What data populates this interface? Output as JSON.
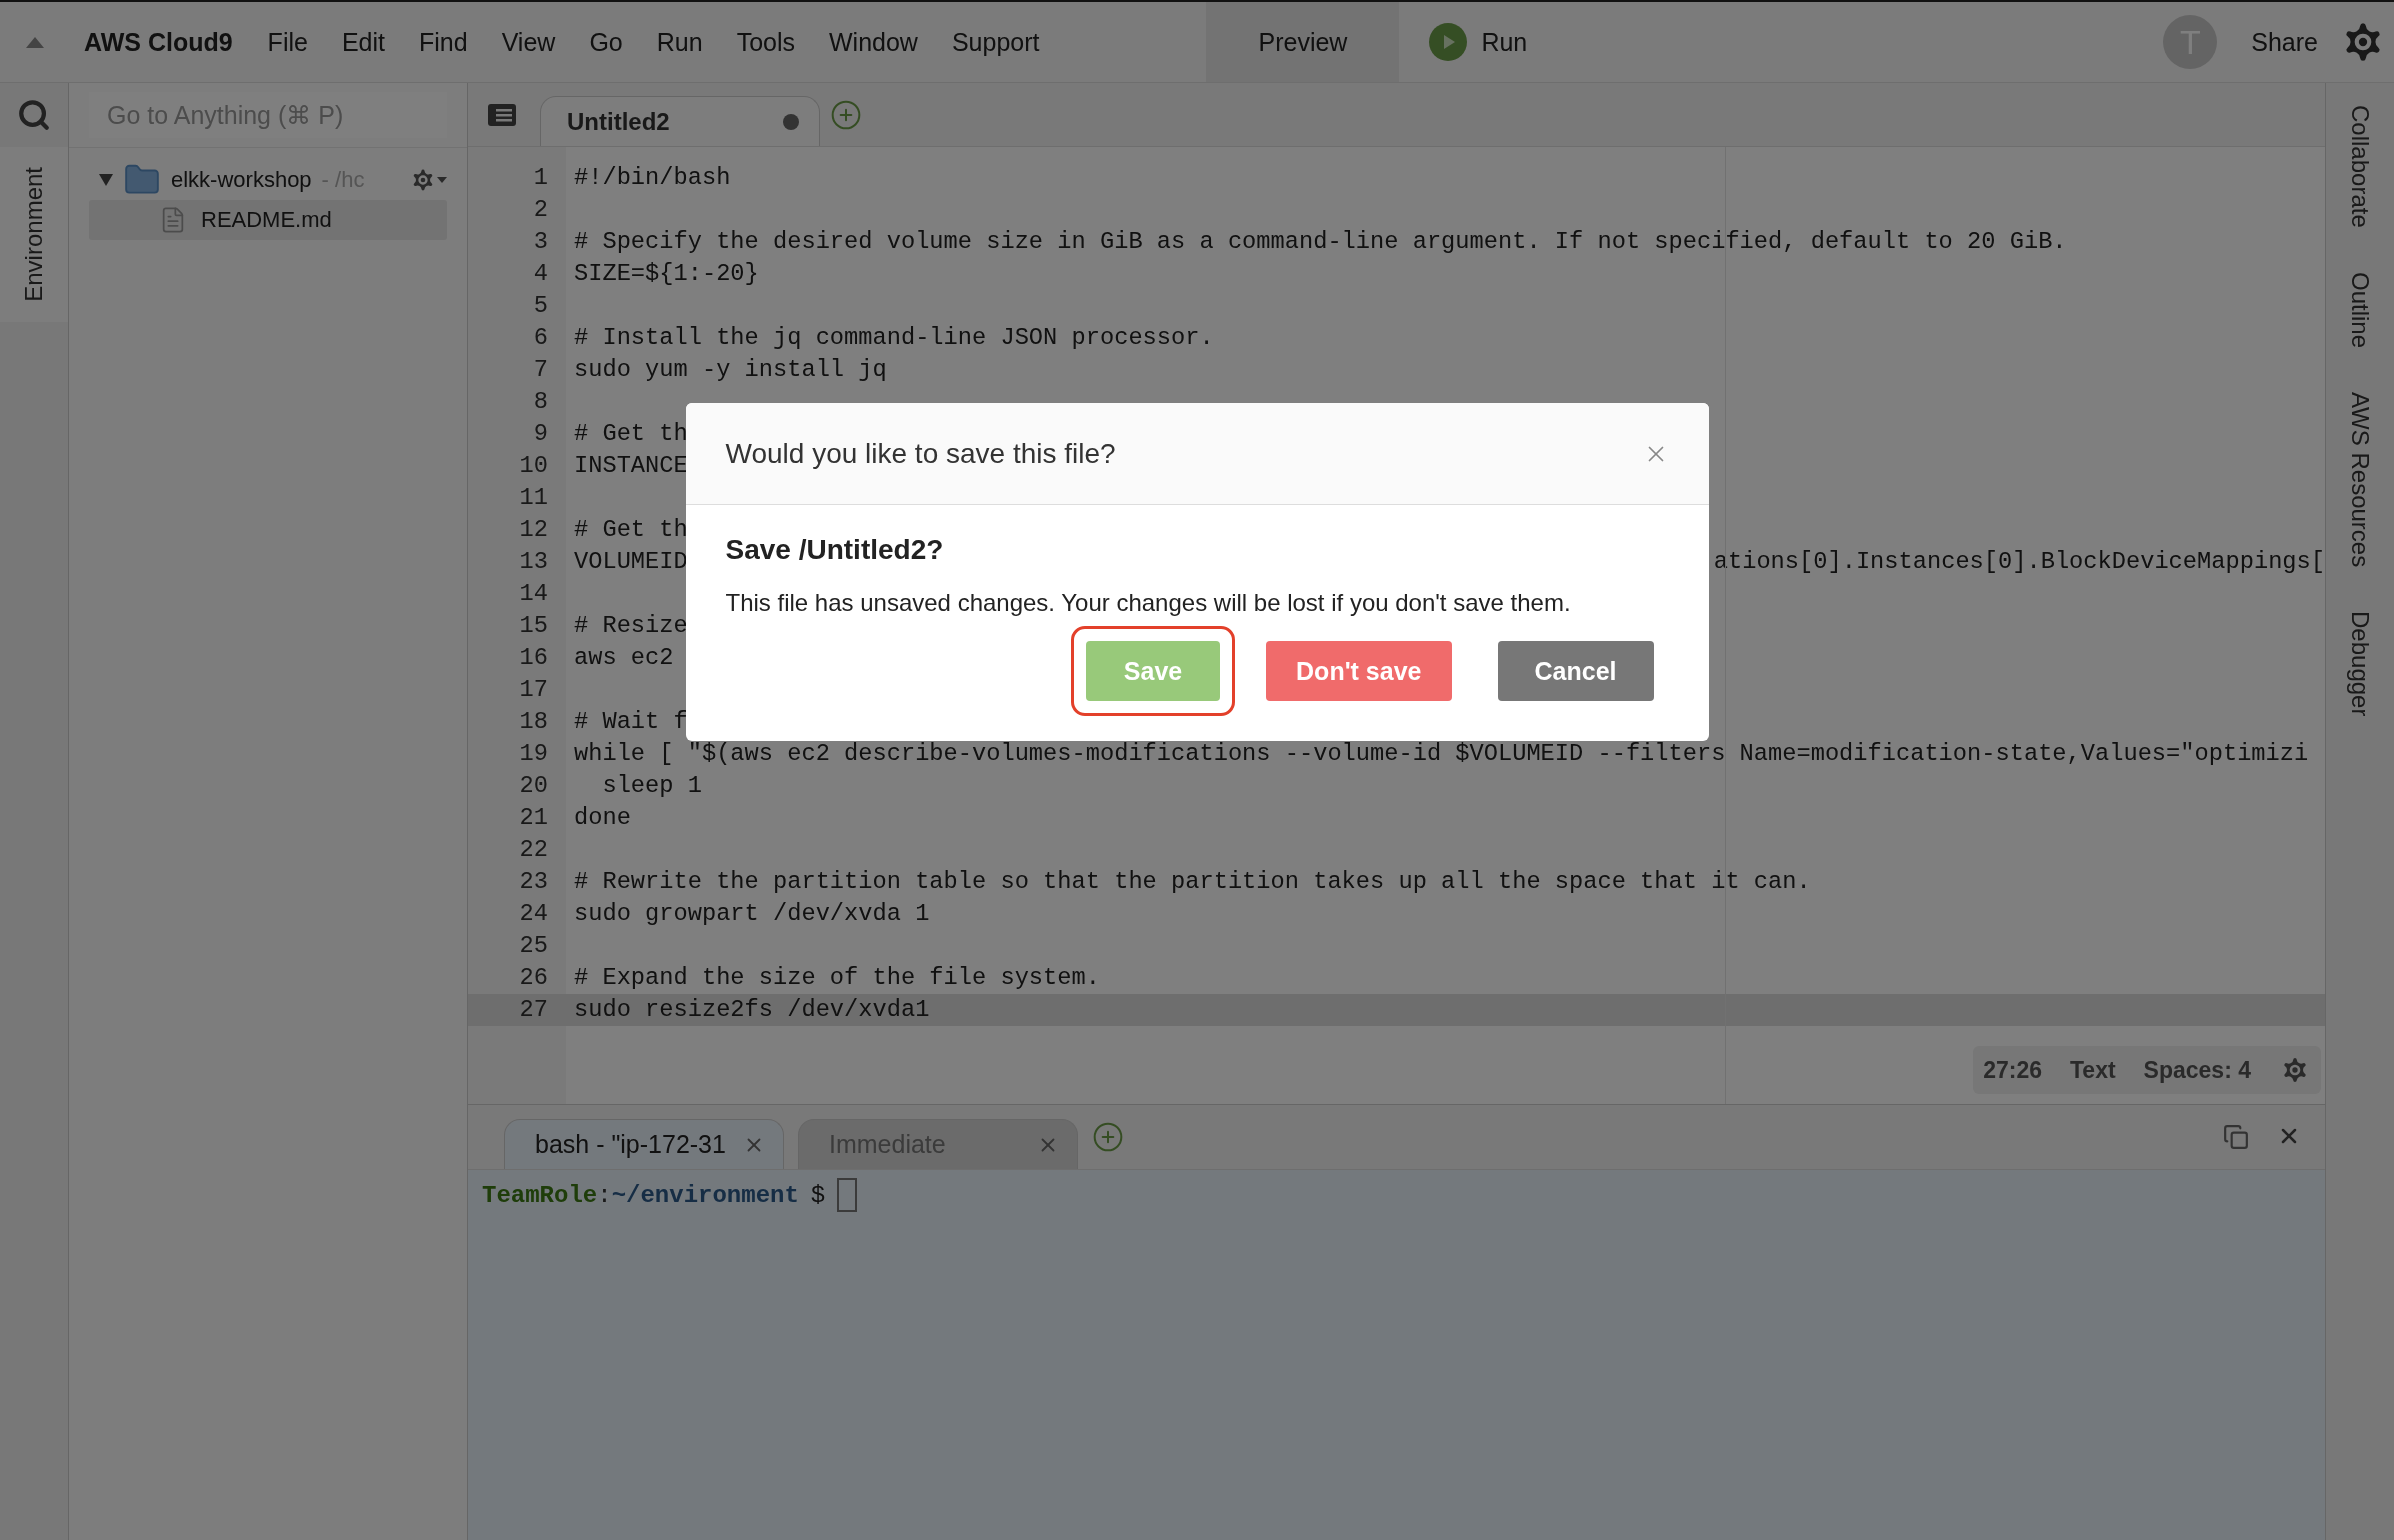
{
  "menubar": {
    "brand": "AWS Cloud9",
    "menus": [
      "File",
      "Edit",
      "Find",
      "View",
      "Go",
      "Run",
      "Tools",
      "Window",
      "Support"
    ],
    "preview": "Preview",
    "run": "Run",
    "avatar": "T",
    "share": "Share"
  },
  "left_rail": [
    {
      "label": "Environment",
      "selected": true
    }
  ],
  "search": {
    "placeholder": "Go to Anything (⌘ P)"
  },
  "tree": [
    {
      "name": "elkk-workshop",
      "path": "- /hc",
      "expanded": true,
      "children": [
        {
          "name": "README.md",
          "selected": true
        }
      ]
    }
  ],
  "editor_tabs": [
    {
      "label": "Untitled2",
      "selected": true,
      "unsaved": true
    }
  ],
  "code_lines": [
    {
      "number": "1",
      "text": "#!/bin/bash",
      "current": false
    },
    {
      "number": "2",
      "current": false
    },
    {
      "number": "3",
      "text": "# Specify the desired volume size in GiB as a command-line argument. If not specified, default to 20 GiB.",
      "current": false
    },
    {
      "number": "4",
      "text": "SIZE=${1:-20}",
      "current": false
    },
    {
      "number": "5",
      "current": false
    },
    {
      "number": "6",
      "text": "# Install the jq command-line JSON processor.",
      "current": false
    },
    {
      "number": "7",
      "text": "sudo yum -y install jq",
      "current": false
    },
    {
      "number": "8",
      "current": false
    },
    {
      "number": "9",
      "text": "# Get th",
      "current": false
    },
    {
      "number": "10",
      "text": "INSTANCE",
      "current": false
    },
    {
      "number": "11",
      "current": false
    },
    {
      "number": "12",
      "text": "# Get th",
      "current": false
    },
    {
      "number": "13",
      "text": "VOLUMEID",
      "tail": "ations[0].Instances[0].BlockDeviceMappings[",
      "current": false
    },
    {
      "number": "14",
      "current": false
    },
    {
      "number": "15",
      "text": "# Resize",
      "current": false
    },
    {
      "number": "16",
      "text": "aws ec2",
      "current": false
    },
    {
      "number": "17",
      "current": false
    },
    {
      "number": "18",
      "text": "# Wait f",
      "current": false
    },
    {
      "number": "19",
      "text": "while [ \"$(aws ec2 describe-volumes-modifications --volume-id $VOLUMEID --filters Name=modification-state,Values=\"optimizi",
      "current": false
    },
    {
      "number": "20",
      "text": "  sleep 1",
      "current": false
    },
    {
      "number": "21",
      "text": "done",
      "current": false
    },
    {
      "number": "22",
      "current": false
    },
    {
      "number": "23",
      "text": "# Rewrite the partition table so that the partition takes up all the space that it can.",
      "current": false
    },
    {
      "number": "24",
      "text": "sudo growpart /dev/xvda 1",
      "current": false
    },
    {
      "number": "25",
      "current": false
    },
    {
      "number": "26",
      "text": "# Expand the size of the file system.",
      "current": false
    },
    {
      "number": "27",
      "text": "sudo resize2fs /dev/xvda1",
      "current": true
    }
  ],
  "status": {
    "position": "27:26",
    "mode": "Text",
    "indent": "Spaces: 4"
  },
  "terminal_tabs": [
    {
      "label": "bash - \"ip-172-31",
      "selected": true
    },
    {
      "label": "Immediate",
      "selected": false
    }
  ],
  "terminal": {
    "user": "TeamRole",
    "separator": ":",
    "path": "~/environment",
    "prompt": "$"
  },
  "right_rail": [
    "Collaborate",
    "Outline",
    "AWS Resources",
    "Debugger"
  ],
  "dialog": {
    "title": "Would you like to save this file?",
    "heading": "Save /Untitled2?",
    "message": "This file has unsaved changes. Your changes will be lost if you don't save them.",
    "buttons": [
      {
        "label": "Save",
        "kind": "primary",
        "highlighted": true
      },
      {
        "label": "Don't save",
        "kind": "danger",
        "highlighted": false
      },
      {
        "label": "Cancel",
        "kind": "neutral",
        "highlighted": false
      }
    ]
  }
}
